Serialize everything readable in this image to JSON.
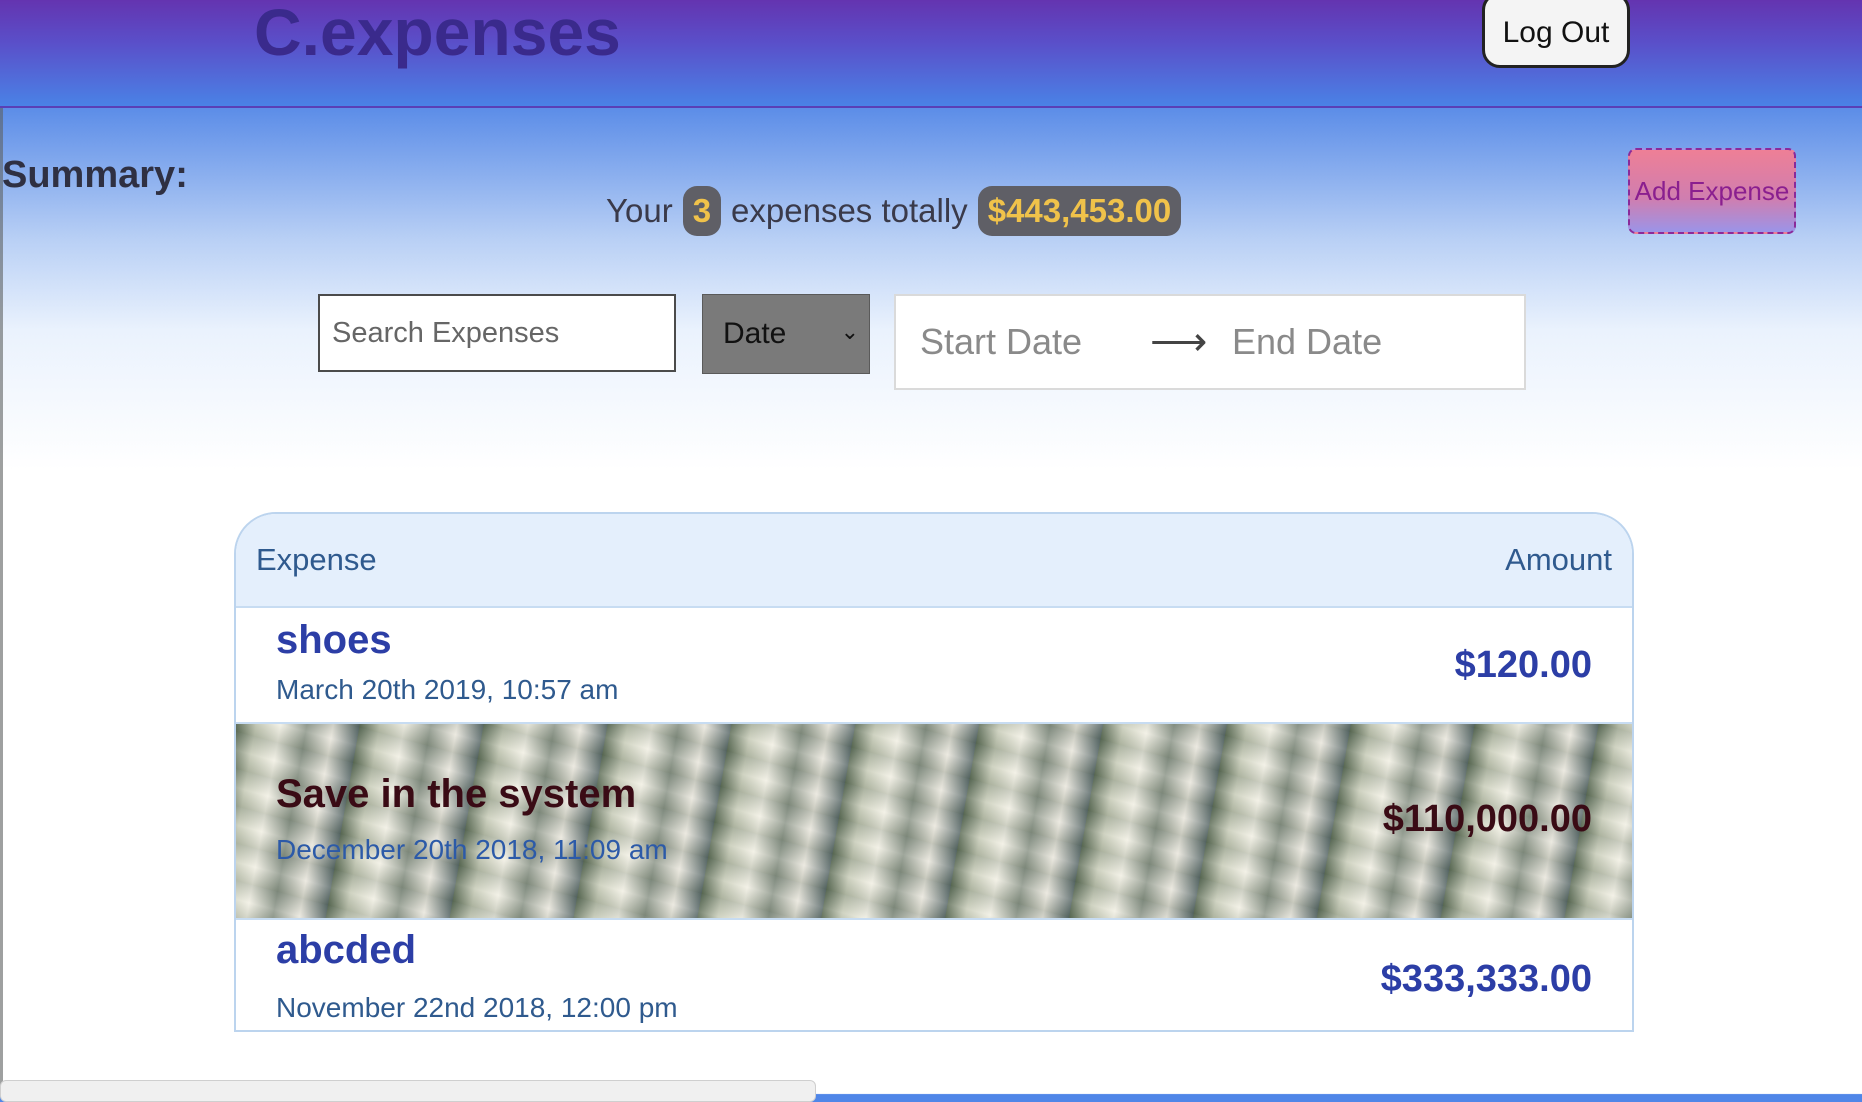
{
  "header": {
    "brand": "C.expenses",
    "logout_label": "Log Out"
  },
  "summary": {
    "title": "Summary:",
    "prefix": "Your",
    "count": "3",
    "middle": "expenses totally",
    "total": "$443,453.00",
    "add_expense_label": "Add Expense"
  },
  "filters": {
    "search_placeholder": "Search Expenses",
    "sort_selected": "Date",
    "start_date_placeholder": "Start Date",
    "end_date_placeholder": "End Date"
  },
  "table": {
    "columns": [
      "Expense",
      "Amount"
    ],
    "rows": [
      {
        "name": "shoes",
        "date": "March 20th 2019, 10:57 am",
        "amount": "$120.00"
      },
      {
        "name": "Save in the system",
        "date": "December 20th 2018, 11:09 am",
        "amount": "$110,000.00"
      },
      {
        "name": "abcded",
        "date": "November 22nd 2018, 12:00 pm",
        "amount": "$333,333.00"
      }
    ]
  }
}
